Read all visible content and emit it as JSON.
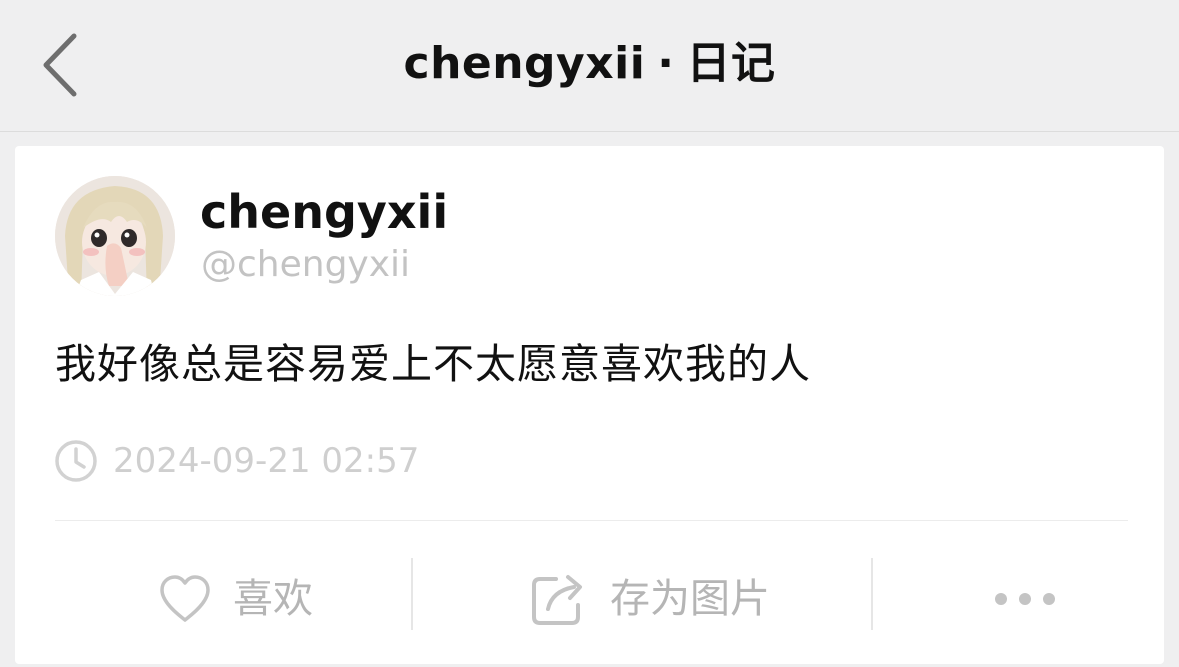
{
  "nav": {
    "title_name": "chengyxii",
    "title_sep": "·",
    "title_suffix": "日记",
    "back_icon": "chevron-left-icon"
  },
  "post": {
    "display_name": "chengyxii",
    "handle": "@chengyxii",
    "text": "我好像总是容易爱上不太愿意喜欢我的人",
    "timestamp": "2024-09-21 02:57",
    "time_icon": "clock-icon"
  },
  "actions": {
    "like_label": "喜欢",
    "like_icon": "heart-icon",
    "save_image_label": "存为图片",
    "save_image_icon": "share-out-icon",
    "more_icon": "more-dots-icon"
  },
  "colors": {
    "background": "#efeff0",
    "card": "#ffffff",
    "text_primary": "#111111",
    "text_muted": "#c3c3c3",
    "action_muted": "#b5b5b5"
  }
}
